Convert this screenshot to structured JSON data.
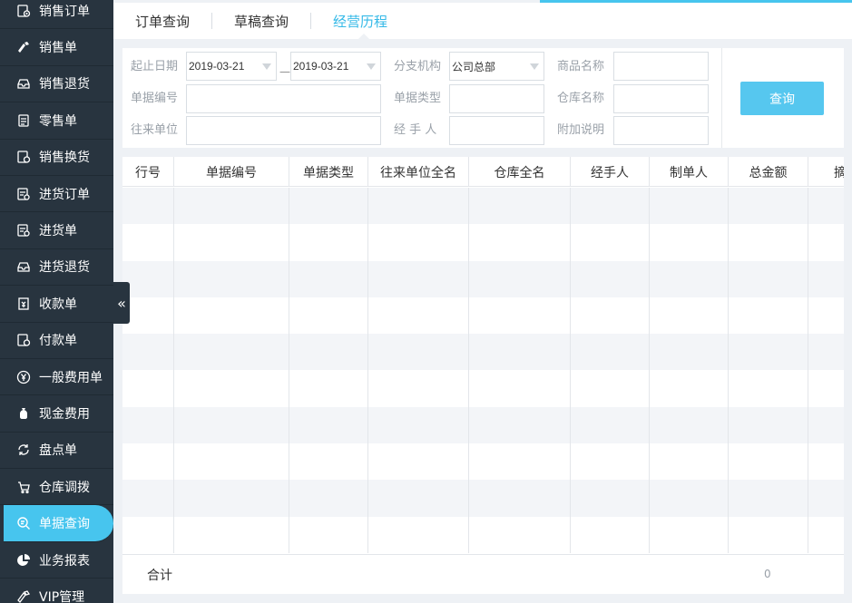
{
  "sidebar": {
    "items": [
      {
        "label": "销售订单",
        "icon": "sales-order-icon"
      },
      {
        "label": "销售单",
        "icon": "sales-slip-icon"
      },
      {
        "label": "销售退货",
        "icon": "sales-return-icon"
      },
      {
        "label": "零售单",
        "icon": "retail-slip-icon"
      },
      {
        "label": "销售换货",
        "icon": "sales-exchange-icon"
      },
      {
        "label": "进货订单",
        "icon": "purchase-order-icon"
      },
      {
        "label": "进货单",
        "icon": "purchase-slip-icon"
      },
      {
        "label": "进货退货",
        "icon": "purchase-return-icon"
      },
      {
        "label": "收款单",
        "icon": "receipt-icon"
      },
      {
        "label": "付款单",
        "icon": "payment-icon"
      },
      {
        "label": "一般费用单",
        "icon": "yen-icon"
      },
      {
        "label": "现金费用",
        "icon": "money-bag-icon"
      },
      {
        "label": "盘点单",
        "icon": "stocktake-icon"
      },
      {
        "label": "仓库调拨",
        "icon": "warehouse-transfer-icon"
      },
      {
        "label": "单据查询",
        "icon": "document-search-icon"
      },
      {
        "label": "业务报表",
        "icon": "pie-chart-icon"
      },
      {
        "label": "VIP管理",
        "icon": "vip-icon"
      }
    ],
    "active_index": 14
  },
  "tabs": [
    {
      "label": "订单查询"
    },
    {
      "label": "草稿查询"
    },
    {
      "label": "经营历程"
    }
  ],
  "filter": {
    "date_label": "起止日期",
    "date_from": "2019-03-21",
    "date_sep": "—",
    "date_to": "2019-03-21",
    "branch_label": "分支机构",
    "branch_value": "公司总部",
    "product_label": "商品名称",
    "product_value": "",
    "doc_no_label": "单据编号",
    "doc_no_value": "",
    "doc_type_label": "单据类型",
    "doc_type_value": "",
    "warehouse_label": "仓库名称",
    "warehouse_value": "",
    "partner_label": "往来单位",
    "partner_value": "",
    "handler_label": "经 手 人",
    "handler_value": "",
    "note_label": "附加说明",
    "note_value": "",
    "query_button": "查询"
  },
  "table": {
    "columns": [
      "行号",
      "单据编号",
      "单据类型",
      "往来单位全名",
      "仓库全名",
      "经手人",
      "制单人",
      "总金额",
      "摘"
    ],
    "rows": [],
    "footer_label": "合计",
    "footer_total": "0"
  },
  "colors": {
    "sidebar_bg": "#28343f",
    "accent": "#47c5ee",
    "query_button": "#56c7ef"
  }
}
